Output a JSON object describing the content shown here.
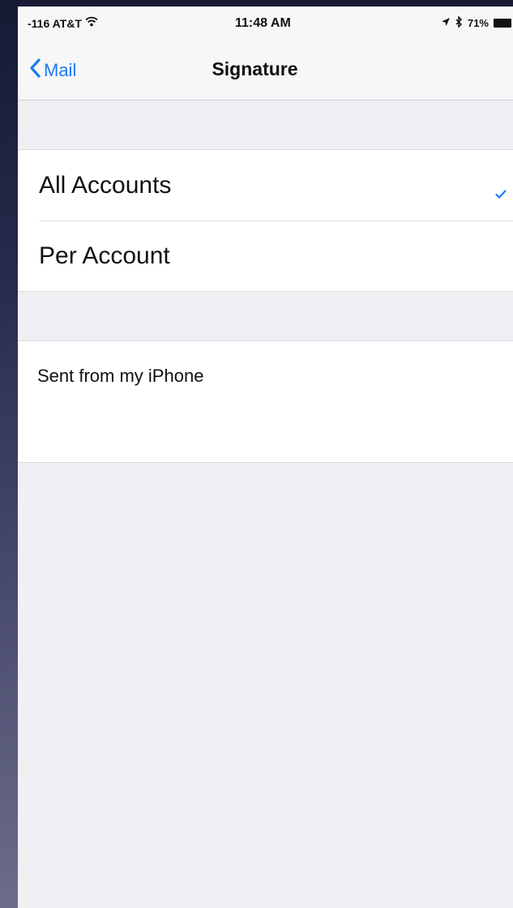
{
  "status_bar": {
    "carrier": "-116 AT&T",
    "wifi_icon": "wifi-icon",
    "time": "11:48 AM",
    "location_icon": "location-arrow-icon",
    "bluetooth_icon": "bluetooth-icon",
    "battery": "71%",
    "battery_icon": "battery-icon"
  },
  "nav": {
    "back_label": "Mail",
    "back_icon": "chevron-left-icon",
    "title": "Signature"
  },
  "signature_scope": {
    "options": [
      {
        "label": "All Accounts",
        "selected": true
      },
      {
        "label": "Per Account",
        "selected": false
      }
    ],
    "check_icon": "checkmark-icon"
  },
  "signature": {
    "text": "Sent from my iPhone"
  },
  "colors": {
    "accent": "#1a7cf5",
    "background": "#efeff4",
    "cell": "#ffffff"
  }
}
